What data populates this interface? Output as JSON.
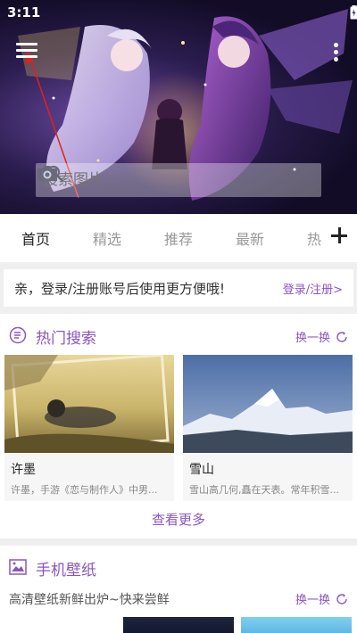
{
  "status_bar": {
    "time": "3:11"
  },
  "search": {
    "placeholder": "搜索图片"
  },
  "tabs": [
    {
      "label": "首页",
      "active": true
    },
    {
      "label": "精选"
    },
    {
      "label": "推荐"
    },
    {
      "label": "最新"
    },
    {
      "label": "热"
    }
  ],
  "login_bar": {
    "message": "亲，登录/注册账号后使用更方便哦!",
    "link": "登录/注册>"
  },
  "hot_search": {
    "title": "热门搜索",
    "swap_label": "换一换",
    "items": [
      {
        "name": "许墨",
        "desc": "许墨，手游《恋与制作人》中男..."
      },
      {
        "name": "雪山",
        "desc": "雪山高几何,矗在天表。常年积雪..."
      }
    ],
    "more_label": "查看更多"
  },
  "wallpaper": {
    "title": "手机壁纸",
    "subtitle": "高清壁纸新鲜出炉~快来尝鲜",
    "swap_label": "换一换"
  },
  "colors": {
    "accent": "#8a56c2"
  }
}
